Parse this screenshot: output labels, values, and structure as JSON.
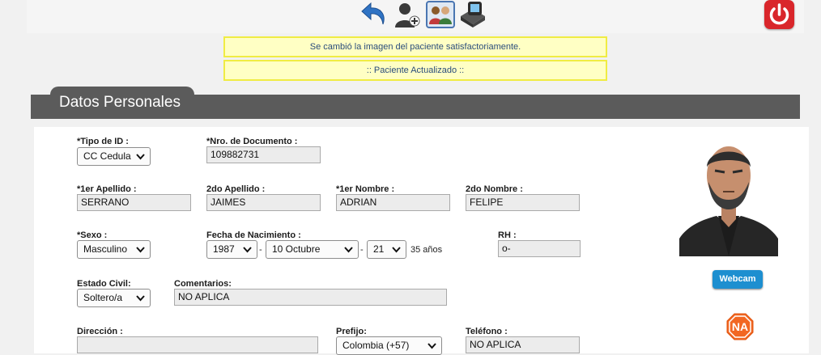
{
  "toolbar": {
    "icons": [
      "back-arrow-icon",
      "add-user-icon",
      "patients-icon",
      "sync-icon"
    ],
    "power_icon": "power-icon"
  },
  "messages": {
    "image_changed": "Se cambió la imagen del paciente satisfactoriamente.",
    "patient_updated": ":: Paciente Actualizado ::"
  },
  "section": {
    "title": "Datos Personales"
  },
  "form": {
    "tipo_id": {
      "label": "*Tipo de ID :",
      "value": "CC Cedula"
    },
    "nro_documento": {
      "label": "*Nro. de Documento :",
      "value": "109882731"
    },
    "primer_apellido": {
      "label": "*1er Apellido :",
      "value": "SERRANO"
    },
    "segundo_apellido": {
      "label": "2do Apellido :",
      "value": "JAIMES"
    },
    "primer_nombre": {
      "label": "*1er Nombre :",
      "value": "ADRIAN"
    },
    "segundo_nombre": {
      "label": "2do Nombre :",
      "value": "FELIPE"
    },
    "sexo": {
      "label": "*Sexo :",
      "value": "Masculino"
    },
    "fecha_nacimiento": {
      "label": "Fecha de Nacimiento :",
      "year": "1987",
      "separator": "-",
      "month": "10 Octubre",
      "day": "21",
      "age": "35 años"
    },
    "rh": {
      "label": "RH :",
      "value": "o-"
    },
    "estado_civil": {
      "label": "Estado Civil:",
      "value": "Soltero/a"
    },
    "comentarios": {
      "label": "Comentarios:",
      "value": "NO APLICA"
    },
    "direccion": {
      "label": "Dirección :",
      "value": ""
    },
    "prefijo": {
      "label": "Prefijo:",
      "value": "Colombia (+57)"
    },
    "telefono": {
      "label": "Teléfono :",
      "value": "NO APLICA"
    }
  },
  "side": {
    "webcam_label": "Webcam",
    "na_badge": "NA"
  },
  "colors": {
    "section_bar": "#5b5b5b",
    "message_bg": "#ffffc4",
    "message_border": "#f0ec43",
    "webcam": "#1d8fd0",
    "power": "#d9262b",
    "na_badge": "#f26722"
  }
}
